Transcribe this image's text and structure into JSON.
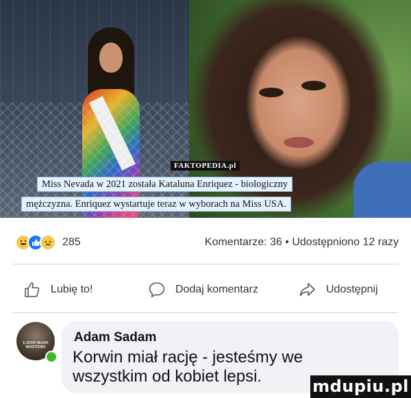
{
  "post": {
    "image": {
      "brand": "FAKTOPEDIA.pl",
      "caption_line1": "Miss Nevada w 2021 została Kataluna Enriquez - biologiczny",
      "caption_line2": "mężczyzna. Enriquez wystartuje teraz w wyborach na Miss USA."
    },
    "reactions": {
      "icons": [
        "haha-icon",
        "like-icon",
        "sad-icon"
      ],
      "count": "285"
    },
    "stats": {
      "text": "Komentarze: 36 • Udostępniono 12 razy"
    },
    "actions": {
      "like_label": "Lubię to!",
      "comment_label": "Dodaj komentarz",
      "share_label": "Udostępnij"
    }
  },
  "comment": {
    "author": "Adam Sadam",
    "text": "Korwin miał rację - jesteśmy we wszystkim od kobiet lepsi.",
    "avatar_text": "LATIN MASS MATTERS"
  },
  "watermark": "mdupiu.pl",
  "colors": {
    "like_blue": "#1877f2",
    "online_green": "#42b72a",
    "bubble_bg": "#f0f2f5",
    "caption_bg": "#e4f1ff"
  }
}
